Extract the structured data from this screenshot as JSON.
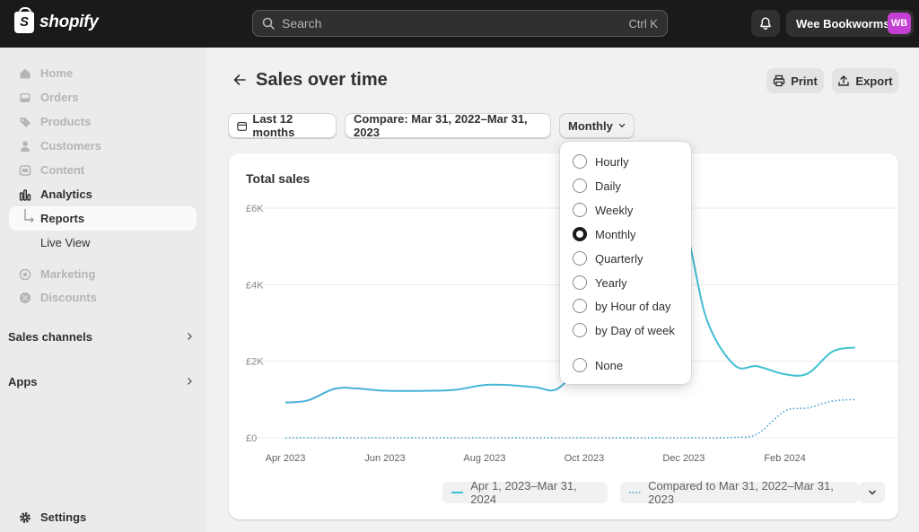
{
  "topbar": {
    "brand": "shopify",
    "search_placeholder": "Search",
    "search_shortcut": "Ctrl K",
    "store_name": "Wee Bookworms",
    "store_initials": "WB"
  },
  "sidebar": {
    "items": [
      {
        "label": "Home",
        "icon": "home-icon"
      },
      {
        "label": "Orders",
        "icon": "inbox-icon"
      },
      {
        "label": "Products",
        "icon": "tag-icon"
      },
      {
        "label": "Customers",
        "icon": "person-icon"
      },
      {
        "label": "Content",
        "icon": "content-icon"
      },
      {
        "label": "Analytics",
        "icon": "bar-chart-icon"
      },
      {
        "label": "Reports",
        "icon": "subitem-arrow-icon"
      },
      {
        "label": "Live View",
        "icon": ""
      },
      {
        "label": "Marketing",
        "icon": "target-icon"
      },
      {
        "label": "Discounts",
        "icon": "discount-icon"
      }
    ],
    "sales_channels": "Sales channels",
    "apps": "Apps",
    "settings": "Settings"
  },
  "header": {
    "title": "Sales over time",
    "print": "Print",
    "export": "Export"
  },
  "filters": {
    "date_range": "Last 12 months",
    "compare": "Compare: Mar 31, 2022–Mar 31, 2023",
    "granularity": "Monthly"
  },
  "granularity_menu": {
    "selected": "Monthly",
    "options": [
      "Hourly",
      "Daily",
      "Weekly",
      "Monthly",
      "Quarterly",
      "Yearly",
      "by Hour of day",
      "by Day of week",
      "None"
    ]
  },
  "card": {
    "title": "Total sales"
  },
  "colors": {
    "primary_series": "#3fbfd5",
    "comparison_series": "#4fa4d8",
    "avatar": "#c43fd3",
    "topbar": "#1a1a1a"
  },
  "chart_data": {
    "type": "line",
    "title": "Total sales",
    "x_tick_labels": [
      "Apr 2023",
      "Jun 2023",
      "Aug 2023",
      "Oct 2023",
      "Dec 2023",
      "Feb 2024"
    ],
    "y_tick_labels": [
      "£6K",
      "£4K",
      "£2K",
      "£0"
    ],
    "ylim": [
      0,
      6000
    ],
    "grid": true,
    "legend_position": "bottom-right",
    "series": [
      {
        "name": "Apr 1, 2023–Mar 31, 2024",
        "style": "solid",
        "points": [
          [
            "2023-04-01",
            920
          ],
          [
            "2023-04-15",
            980
          ],
          [
            "2023-05-01",
            1280
          ],
          [
            "2023-05-15",
            1290
          ],
          [
            "2023-06-01",
            1230
          ],
          [
            "2023-07-01",
            1230
          ],
          [
            "2023-07-15",
            1260
          ],
          [
            "2023-08-01",
            1380
          ],
          [
            "2023-08-15",
            1380
          ],
          [
            "2023-09-01",
            1320
          ],
          [
            "2023-09-15",
            1290
          ],
          [
            "2023-10-01",
            2100
          ],
          [
            "2023-10-15",
            3300
          ],
          [
            "2023-11-01",
            4700
          ],
          [
            "2023-11-15",
            5600
          ],
          [
            "2023-12-01",
            5550
          ],
          [
            "2023-12-15",
            3100
          ],
          [
            "2024-01-01",
            1900
          ],
          [
            "2024-01-15",
            1870
          ],
          [
            "2024-02-01",
            1660
          ],
          [
            "2024-02-15",
            1680
          ],
          [
            "2024-03-01",
            2250
          ],
          [
            "2024-03-15",
            2360
          ]
        ]
      },
      {
        "name": "Compared to Mar 31, 2022–Mar 31, 2023",
        "style": "dotted",
        "points": [
          [
            "2023-04-01",
            0
          ],
          [
            "2023-06-01",
            0
          ],
          [
            "2023-08-01",
            0
          ],
          [
            "2023-10-01",
            0
          ],
          [
            "2023-12-01",
            0
          ],
          [
            "2024-01-01",
            10
          ],
          [
            "2024-01-15",
            100
          ],
          [
            "2024-02-01",
            700
          ],
          [
            "2024-02-15",
            780
          ],
          [
            "2024-03-01",
            960
          ],
          [
            "2024-03-15",
            1000
          ]
        ]
      }
    ]
  }
}
